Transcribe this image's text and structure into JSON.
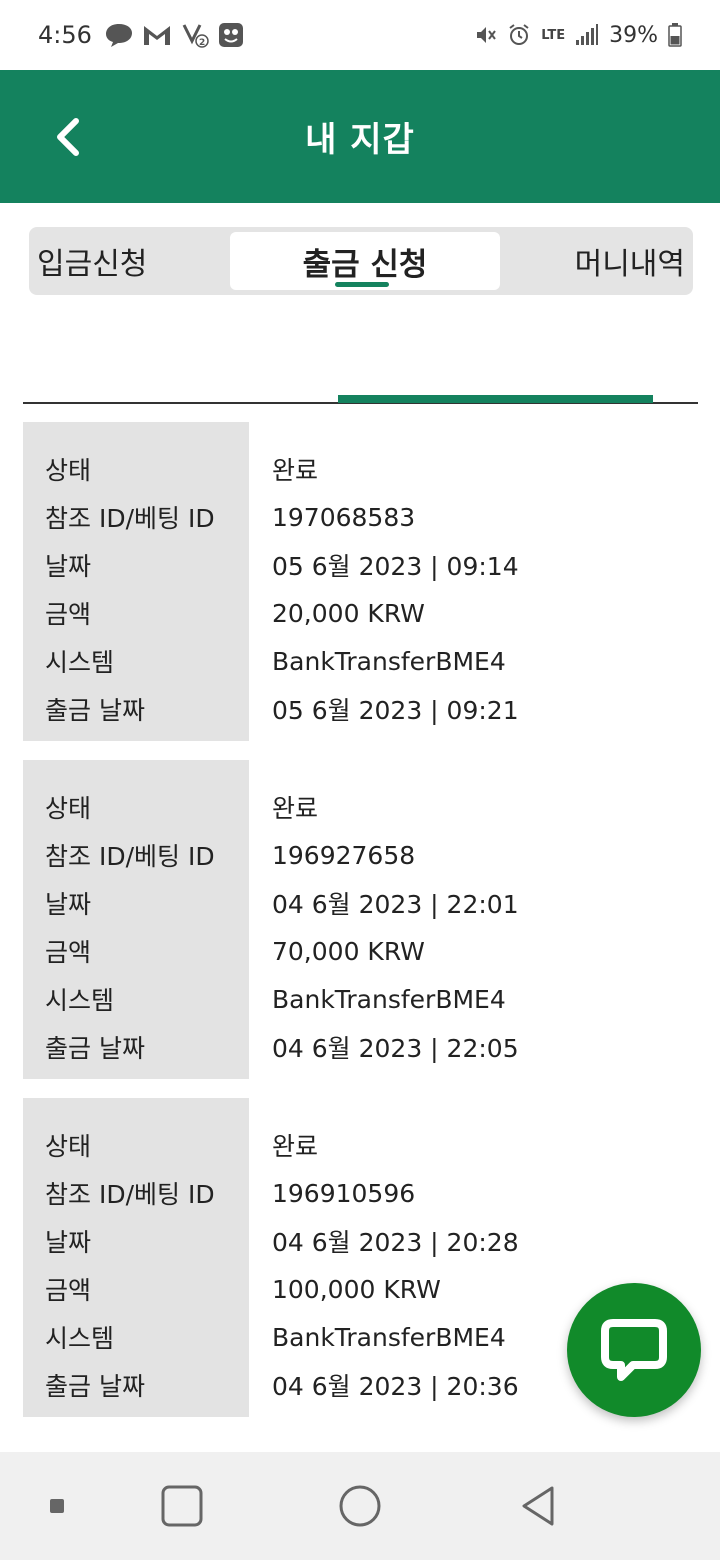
{
  "status_bar": {
    "time": "4:56",
    "network": "LTE",
    "battery": "39%",
    "icons": [
      "chat-bubble-icon",
      "gmail-icon",
      "missed-call-icon",
      "app-icon",
      "mute-icon",
      "alarm-icon",
      "lte-icon",
      "signal-icon",
      "battery-icon"
    ]
  },
  "header": {
    "title": "내 지갑",
    "back_icon": "chevron-left-icon"
  },
  "tabs": {
    "left": "입금신청",
    "active": "출금 신청",
    "right": "머니내역"
  },
  "labels": {
    "status": "상태",
    "ref_id": "참조 ID/베팅 ID",
    "date": "날짜",
    "amount": "금액",
    "system": "시스템",
    "withdraw_date": "출금 날짜"
  },
  "records": [
    {
      "status": "완료",
      "ref_id": "197068583",
      "date": "05 6월 2023 | 09:14",
      "amount": "20,000 KRW",
      "system": "BankTransferBME4",
      "withdraw_date": "05 6월 2023 | 09:21"
    },
    {
      "status": "완료",
      "ref_id": "196927658",
      "date": "04 6월 2023 | 22:01",
      "amount": "70,000 KRW",
      "system": "BankTransferBME4",
      "withdraw_date": "04 6월 2023 | 22:05"
    },
    {
      "status": "완료",
      "ref_id": "196910596",
      "date": "04 6월 2023 | 20:28",
      "amount": "100,000 KRW",
      "system": "BankTransferBME4",
      "withdraw_date": "04 6월 2023 | 20:36"
    }
  ],
  "colors": {
    "brand_green": "#14825e",
    "chat_green": "#118a2a"
  }
}
